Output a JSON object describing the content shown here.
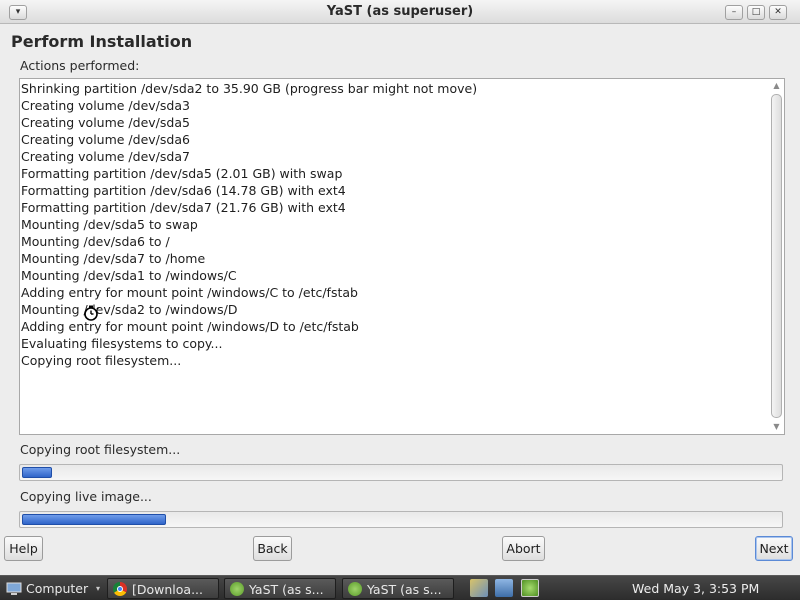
{
  "window": {
    "title": "YaST (as superuser)",
    "menu_glyph": "▾",
    "minimize_glyph": "–",
    "maximize_glyph": "□",
    "close_glyph": "✕"
  },
  "heading": "Perform Installation",
  "actions_label": "Actions performed:",
  "log_lines": [
    "Shrinking partition /dev/sda2 to 35.90 GB (progress bar might not move)",
    "Creating volume /dev/sda3",
    "Creating volume /dev/sda5",
    "Creating volume /dev/sda6",
    "Creating volume /dev/sda7",
    "Formatting partition /dev/sda5 (2.01 GB) with swap",
    "Formatting partition /dev/sda6 (14.78 GB) with ext4",
    "Formatting partition /dev/sda7 (21.76 GB) with ext4",
    "Mounting /dev/sda5 to swap",
    "Mounting /dev/sda6 to /",
    "Mounting /dev/sda7 to /home",
    "Mounting /dev/sda1 to /windows/C",
    "Adding entry for mount point /windows/C to /etc/fstab",
    "Mounting /dev/sda2 to /windows/D",
    "Adding entry for mount point /windows/D to /etc/fstab",
    "Evaluating filesystems to copy...",
    "Copying root filesystem..."
  ],
  "progress1": {
    "label": "Copying root filesystem...",
    "fraction": 0.04
  },
  "progress2": {
    "label": "Copying live image...",
    "fraction": 0.19
  },
  "buttons": {
    "help": "Help",
    "back": "Back",
    "abort": "Abort",
    "next": "Next"
  },
  "taskbar": {
    "start_label": "Computer",
    "tasks": [
      {
        "label": "[Downloa...",
        "icon": "chrome-icon"
      },
      {
        "label": "YaST (as s...",
        "icon": "yast-icon"
      },
      {
        "label": "YaST (as s...",
        "icon": "yast-icon"
      }
    ],
    "clock": "Wed May  3,  3:53 PM"
  },
  "colors": {
    "progress_fill": "#2f65c9",
    "window_bg": "#ededed",
    "taskbar_bg": "#2c2c2c"
  }
}
